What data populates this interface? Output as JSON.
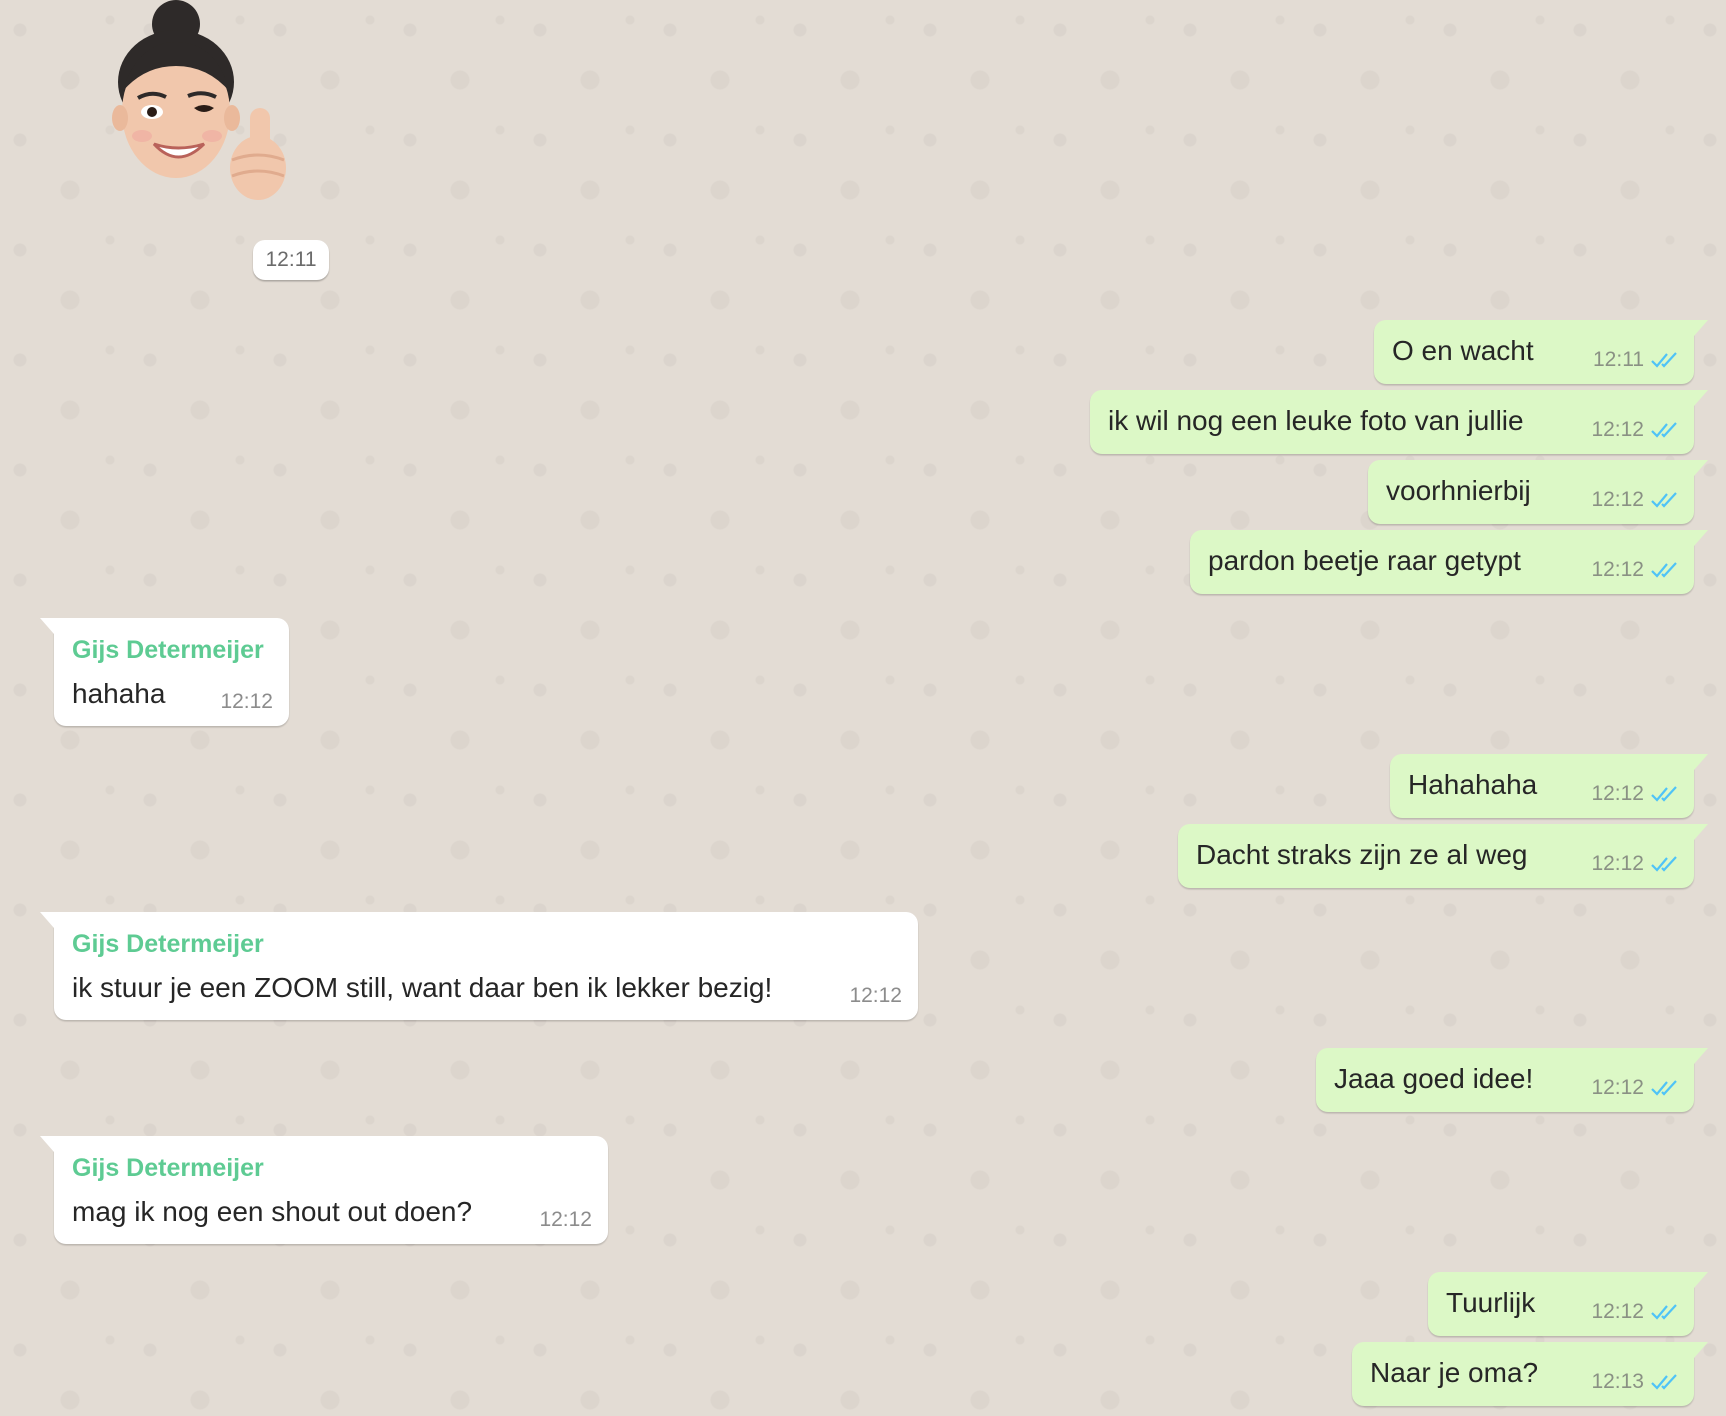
{
  "sticker": {
    "icon": "memoji-thumbs-up-icon",
    "time": "12:11"
  },
  "messages": [
    {
      "text": "O en wacht",
      "time": "12:11"
    },
    {
      "text": "ik wil nog een leuke foto van jullie",
      "time": "12:12"
    },
    {
      "text": "voorhnierbij",
      "time": "12:12"
    },
    {
      "text": "pardon beetje raar getypt",
      "time": "12:12"
    },
    {
      "sender": "Gijs Determeijer",
      "text": "hahaha",
      "time": "12:12"
    },
    {
      "text": "Hahahaha",
      "time": "12:12"
    },
    {
      "text": "Dacht straks zijn ze al weg",
      "time": "12:12"
    },
    {
      "sender": "Gijs Determeijer",
      "text": "ik stuur je een ZOOM still, want daar ben ik lekker bezig!",
      "time": "12:12"
    },
    {
      "text": "Jaaa goed idee!",
      "time": "12:12"
    },
    {
      "sender": "Gijs Determeijer",
      "text": "mag ik nog een shout out doen?",
      "time": "12:12"
    },
    {
      "text": "Tuurlijk",
      "time": "12:12"
    },
    {
      "text": "Naar je oma?",
      "time": "12:13"
    }
  ],
  "colors": {
    "outgoing_bubble": "#dcf8c6",
    "incoming_bubble": "#ffffff",
    "sender_name": "#5ecb93",
    "read_ticks": "#4fc3f7",
    "background": "#e3dcd4"
  }
}
